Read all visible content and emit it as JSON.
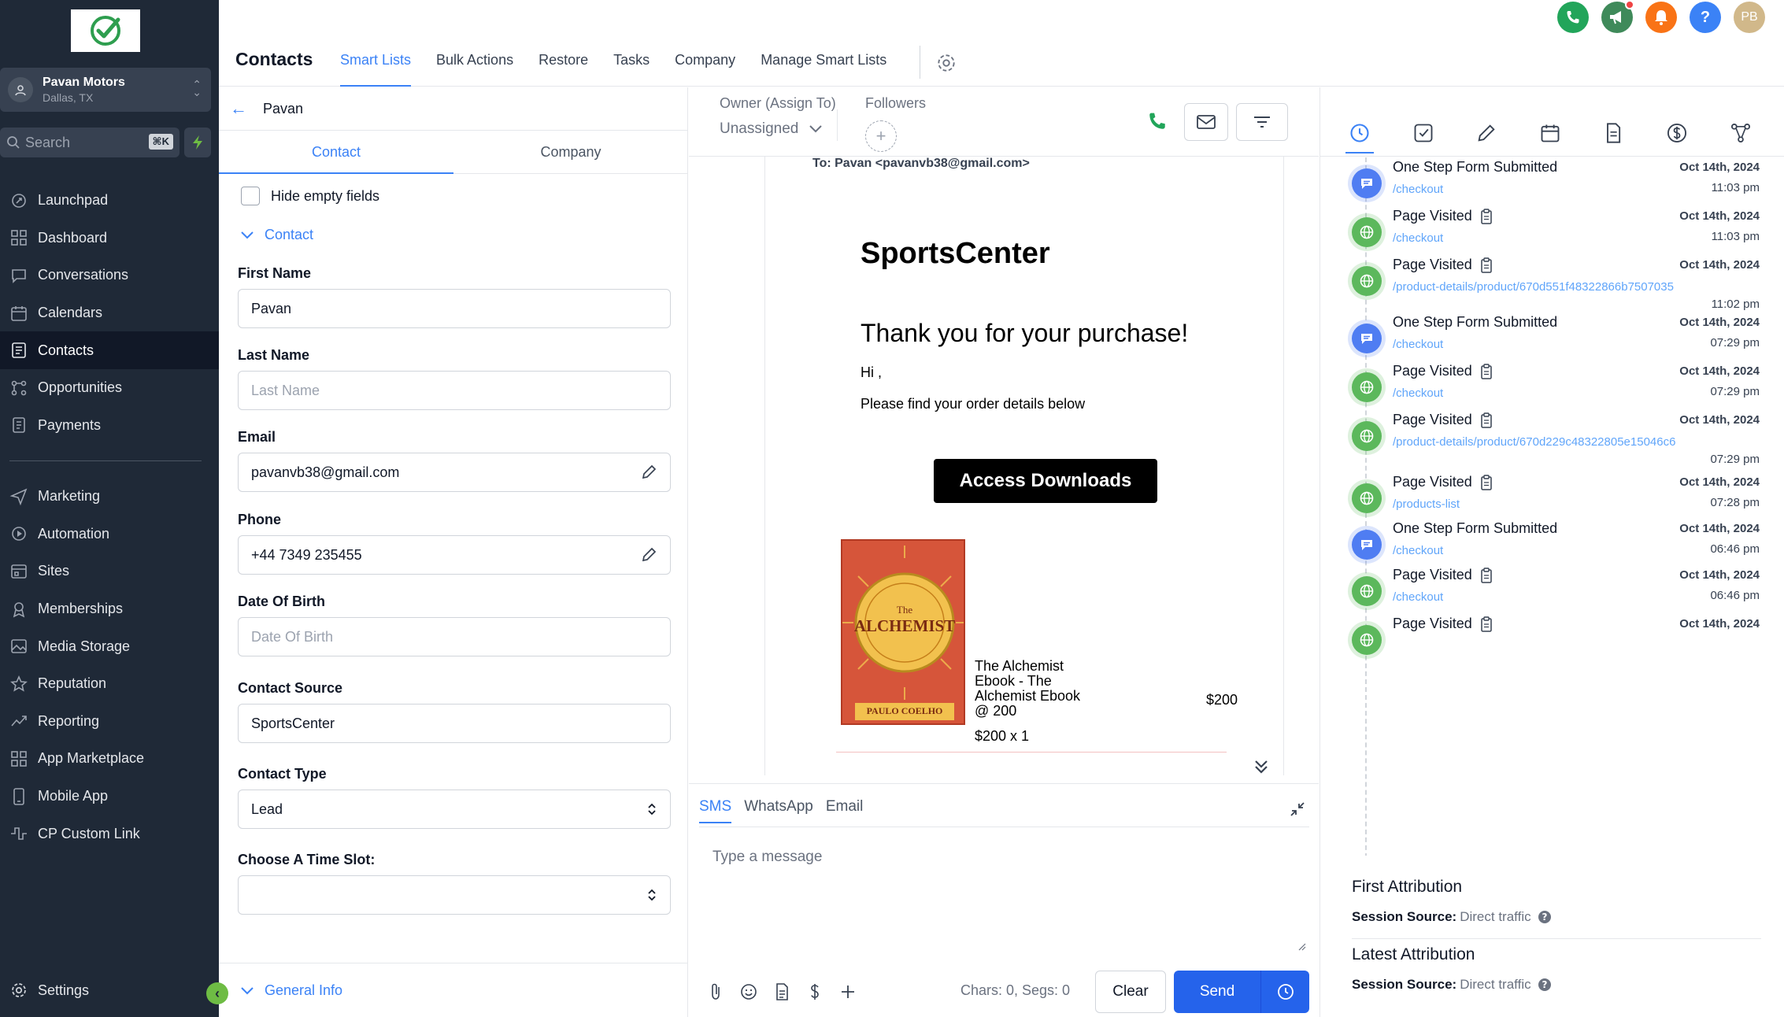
{
  "sidebar": {
    "account_name": "Pavan Motors",
    "account_location": "Dallas, TX",
    "search_placeholder": "Search",
    "search_shortcut": "⌘K",
    "nav_main": [
      {
        "label": "Launchpad",
        "icon": "rocket-icon"
      },
      {
        "label": "Dashboard",
        "icon": "dashboard-icon"
      },
      {
        "label": "Conversations",
        "icon": "chat-icon"
      },
      {
        "label": "Calendars",
        "icon": "calendar-icon"
      },
      {
        "label": "Contacts",
        "icon": "contacts-icon",
        "active": true
      },
      {
        "label": "Opportunities",
        "icon": "opportunities-icon"
      },
      {
        "label": "Payments",
        "icon": "payments-icon"
      }
    ],
    "nav_secondary": [
      {
        "label": "Marketing",
        "icon": "send-icon"
      },
      {
        "label": "Automation",
        "icon": "automation-icon"
      },
      {
        "label": "Sites",
        "icon": "sites-icon"
      },
      {
        "label": "Memberships",
        "icon": "membership-icon"
      },
      {
        "label": "Media Storage",
        "icon": "media-icon"
      },
      {
        "label": "Reputation",
        "icon": "star-icon"
      },
      {
        "label": "Reporting",
        "icon": "reporting-icon"
      },
      {
        "label": "App Marketplace",
        "icon": "marketplace-icon"
      },
      {
        "label": "Mobile App",
        "icon": "mobile-icon"
      },
      {
        "label": "CP Custom Link",
        "icon": "custom-link-icon"
      }
    ],
    "settings_label": "Settings"
  },
  "topbar": {
    "title": "Contacts",
    "tabs": [
      "Smart Lists",
      "Bulk Actions",
      "Restore",
      "Tasks",
      "Company",
      "Manage Smart Lists"
    ],
    "active_tab": "Smart Lists",
    "user_initials": "PB",
    "colors": {
      "phone": "#22a55a",
      "megaphone": "#3f8a5a",
      "bell": "#f97316",
      "help": "#3b82f6",
      "avatar": "#d1b88a"
    }
  },
  "contact_panel": {
    "contact_name": "Pavan",
    "tabs": [
      "Contact",
      "Company"
    ],
    "active_tab": "Contact",
    "hide_empty_label": "Hide empty fields",
    "section_label": "Contact",
    "fields": {
      "first_name": {
        "label": "First Name",
        "value": "Pavan"
      },
      "last_name": {
        "label": "Last Name",
        "placeholder": "Last Name"
      },
      "email": {
        "label": "Email",
        "value": "pavanvb38@gmail.com"
      },
      "phone": {
        "label": "Phone",
        "value": "+44 7349 235455"
      },
      "dob": {
        "label": "Date Of Birth",
        "placeholder": "Date Of Birth"
      },
      "source": {
        "label": "Contact Source",
        "value": "SportsCenter"
      },
      "type": {
        "label": "Contact Type",
        "value": "Lead"
      },
      "time_slot": {
        "label": "Choose A Time Slot:",
        "value": ""
      }
    },
    "general_info_label": "General Info"
  },
  "conversation": {
    "owner_label": "Owner (Assign To)",
    "owner_value": "Unassigned",
    "followers_label": "Followers",
    "email_to": "To: Pavan <pavanvb38@gmail.com>",
    "email_brand": "SportsCenter",
    "email_heading": "Thank you for your purchase!",
    "email_greeting": "Hi ,",
    "email_body": "Please find your order details below",
    "email_button": "Access Downloads",
    "book": {
      "the": "The",
      "title": "ALCHEMIST",
      "author": "PAULO COELHO"
    },
    "product_name": "The Alchemist Ebook - The Alchemist Ebook @ 200",
    "product_qty": "$200 x 1",
    "product_price": "$200",
    "composer_tabs": [
      "SMS",
      "WhatsApp",
      "Email"
    ],
    "active_composer_tab": "SMS",
    "message_placeholder": "Type a message",
    "chars_text": "Chars: 0, Segs: 0",
    "clear_label": "Clear",
    "send_label": "Send"
  },
  "activity": {
    "items": [
      {
        "type": "form",
        "name": "One Step Form Submitted",
        "path": "/checkout",
        "date": "Oct 14th, 2024",
        "time": "11:03 pm"
      },
      {
        "type": "page",
        "name": "Page Visited",
        "path": "/checkout",
        "date": "Oct 14th, 2024",
        "time": "11:03 pm"
      },
      {
        "type": "page",
        "name": "Page Visited",
        "path": "/product-details/product/670d551f48322866b7507035",
        "date": "Oct 14th, 2024",
        "time": "11:02 pm"
      },
      {
        "type": "form",
        "name": "One Step Form Submitted",
        "path": "/checkout",
        "date": "Oct 14th, 2024",
        "time": "07:29 pm"
      },
      {
        "type": "page",
        "name": "Page Visited",
        "path": "/checkout",
        "date": "Oct 14th, 2024",
        "time": "07:29 pm"
      },
      {
        "type": "page",
        "name": "Page Visited",
        "path": "/product-details/product/670d229c48322805e15046c6",
        "date": "Oct 14th, 2024",
        "time": "07:29 pm"
      },
      {
        "type": "page",
        "name": "Page Visited",
        "path": "/products-list",
        "date": "Oct 14th, 2024",
        "time": "07:28 pm"
      },
      {
        "type": "form",
        "name": "One Step Form Submitted",
        "path": "/checkout",
        "date": "Oct 14th, 2024",
        "time": "06:46 pm"
      },
      {
        "type": "page",
        "name": "Page Visited",
        "path": "/checkout",
        "date": "Oct 14th, 2024",
        "time": "06:46 pm"
      },
      {
        "type": "page",
        "name": "Page Visited",
        "path": "",
        "date": "Oct 14th, 2024",
        "time": ""
      }
    ],
    "first_attribution_title": "First Attribution",
    "first_attribution_label": "Session Source:",
    "first_attribution_value": "Direct traffic",
    "latest_attribution_title": "Latest Attribution",
    "latest_attribution_label": "Session Source:",
    "latest_attribution_value": "Direct traffic",
    "colors": {
      "form": "#4f7df2",
      "page": "#5cb85c"
    }
  }
}
